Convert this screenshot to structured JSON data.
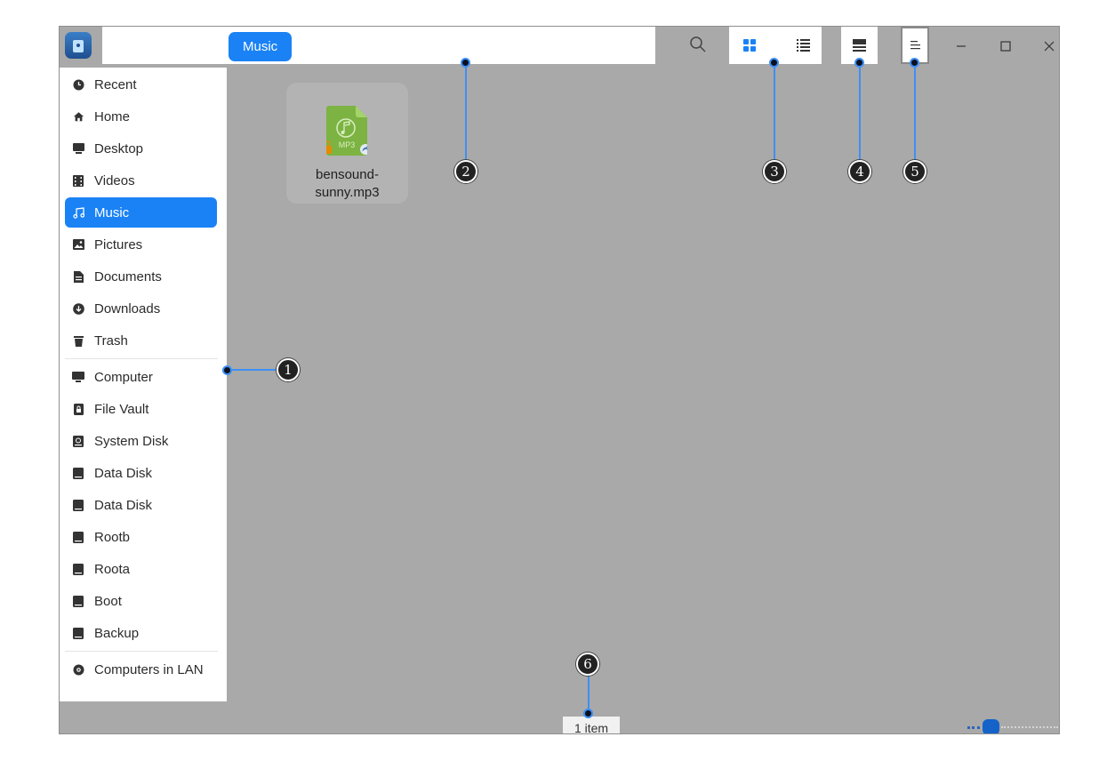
{
  "toolbar": {
    "breadcrumb": "Music",
    "back_icon": "chevron-left-icon",
    "forward_icon": "chevron-right-icon",
    "home_icon": "home-icon",
    "search_icon": "search-icon",
    "icon_view_icon": "grid-icon",
    "list_view_icon": "list-icon",
    "detail_view_icon": "detail-panel-icon",
    "menu_icon": "hamburger-menu-icon",
    "accent": "#1a82f5"
  },
  "sidebar": {
    "items": [
      {
        "label": "Recent",
        "icon": "clock-icon"
      },
      {
        "label": "Home",
        "icon": "home-icon"
      },
      {
        "label": "Desktop",
        "icon": "desktop-icon"
      },
      {
        "label": "Videos",
        "icon": "film-icon"
      },
      {
        "label": "Music",
        "icon": "music-note-icon",
        "active": true
      },
      {
        "label": "Pictures",
        "icon": "picture-icon"
      },
      {
        "label": "Documents",
        "icon": "document-icon"
      },
      {
        "label": "Downloads",
        "icon": "download-icon"
      },
      {
        "label": "Trash",
        "icon": "trash-icon"
      }
    ],
    "devices": [
      {
        "label": "Computer",
        "icon": "computer-icon"
      },
      {
        "label": "File Vault",
        "icon": "vault-icon"
      },
      {
        "label": "System Disk",
        "icon": "system-disk-icon"
      },
      {
        "label": "Data Disk",
        "icon": "disk-icon"
      },
      {
        "label": "Data Disk",
        "icon": "disk-icon"
      },
      {
        "label": "Rootb",
        "icon": "disk-icon"
      },
      {
        "label": "Roota",
        "icon": "disk-icon"
      },
      {
        "label": "Boot",
        "icon": "disk-icon"
      },
      {
        "label": "Backup",
        "icon": "disk-icon"
      }
    ],
    "network": [
      {
        "label": "Computers in LAN",
        "icon": "network-icon"
      }
    ]
  },
  "files": [
    {
      "name": "bensound-sunny.mp3",
      "line1": "bensound-",
      "line2": "sunny.mp3",
      "badge": "MP3",
      "icon": "mp3-file-icon"
    }
  ],
  "status": {
    "text": "1 item"
  },
  "zoom": {
    "level": 0.25
  },
  "callouts": [
    "1",
    "2",
    "3",
    "4",
    "5",
    "6"
  ]
}
